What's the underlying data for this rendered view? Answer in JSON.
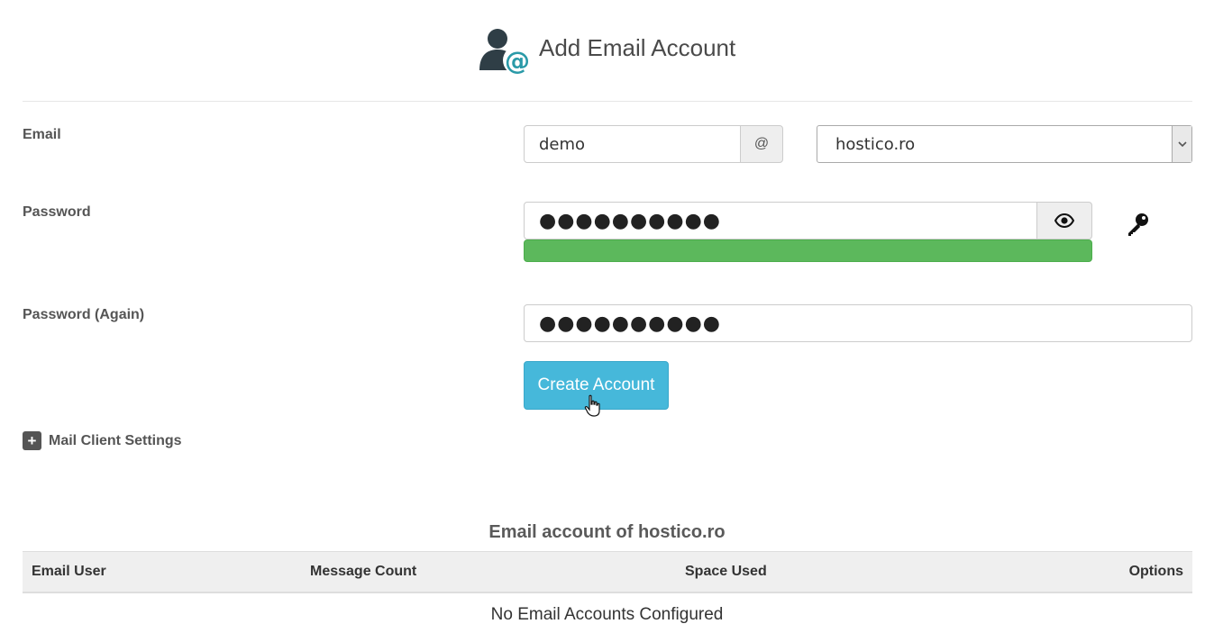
{
  "header": {
    "title": "Add Email Account",
    "icon": "user-email-icon"
  },
  "form": {
    "email": {
      "label": "Email",
      "value": "demo",
      "at_symbol": "@",
      "domain": "hostico.ro"
    },
    "password": {
      "label": "Password",
      "masked_value": "●●●●●●●●●●",
      "show_icon": "eye-icon",
      "generate_icon": "key-icon",
      "strength_color": "#5cb85c",
      "strength": 1.0
    },
    "password_again": {
      "label": "Password (Again)",
      "masked_value": "●●●●●●●●●●"
    },
    "submit_label": "Create Account",
    "accent_color": "#46b8da"
  },
  "mail_client": {
    "label": "Mail Client Settings",
    "icon": "plus-icon"
  },
  "accounts_table": {
    "title": "Email account of hostico.ro",
    "columns": [
      "Email User",
      "Message Count",
      "Space Used",
      "Options"
    ],
    "empty_message": "No Email Accounts Configured"
  }
}
